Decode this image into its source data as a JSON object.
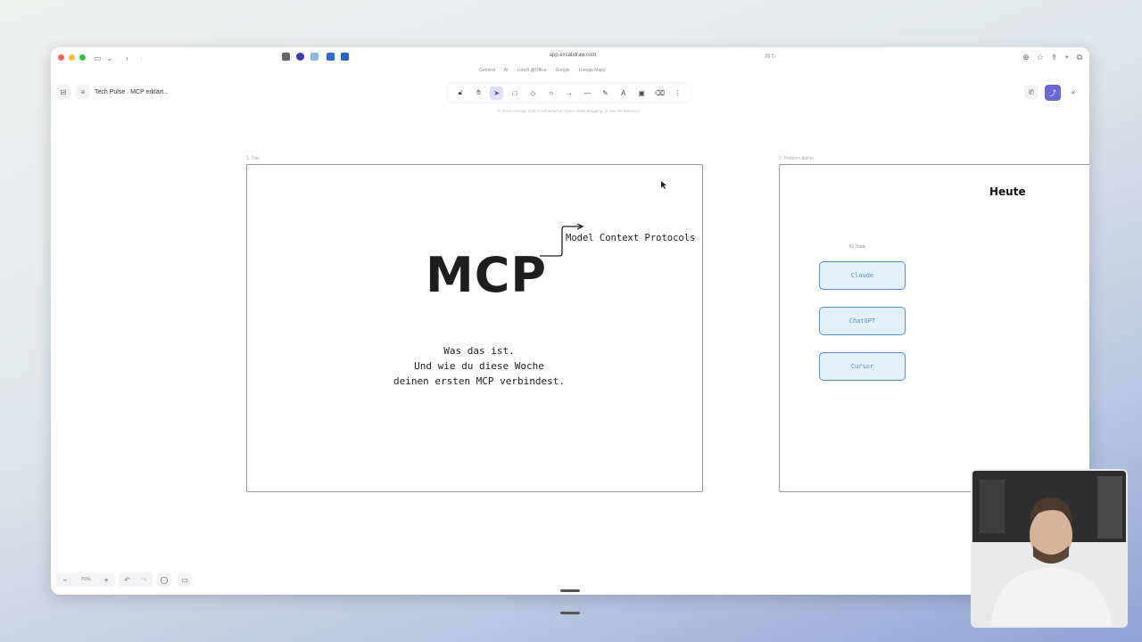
{
  "browser": {
    "url": "app.excalidraw.com",
    "bookmarks": [
      "General",
      "AI",
      "Lunch @Office",
      "Google",
      "Google Maps"
    ]
  },
  "app": {
    "document_title": "Tech Pulse . MCP erklärt...",
    "hint": "To move canvas, hold Scroll wheel or Space while dragging, or use the hand tool",
    "zoom_value": "70%"
  },
  "toolbar": {
    "tools": [
      "lock-icon",
      "hand-icon",
      "selection-icon",
      "rectangle-icon",
      "diamond-icon",
      "ellipse-icon",
      "arrow-icon",
      "line-icon",
      "pencil-icon",
      "text-icon",
      "image-icon",
      "eraser-icon",
      "more-icon"
    ],
    "active_tool": "selection-icon"
  },
  "frames": {
    "frame1": {
      "label": "1. Titel",
      "title": "MCP",
      "arrow_label": "Model Context Protocols",
      "subtitle_line1": "Was das ist.",
      "subtitle_line2": "Und wie du diese Woche",
      "subtitle_line3": "deinen ersten MCP verbindest."
    },
    "frame2": {
      "label": "2. Problem bisher",
      "heading": "Heute",
      "group_label": "KI-Tools",
      "items": [
        "Claude",
        "ChatGPT",
        "Cursor"
      ]
    }
  },
  "colors": {
    "accent": "#6965db",
    "tool_stroke": "#4f8fcf",
    "tool_fill": "#e3f1fb"
  }
}
